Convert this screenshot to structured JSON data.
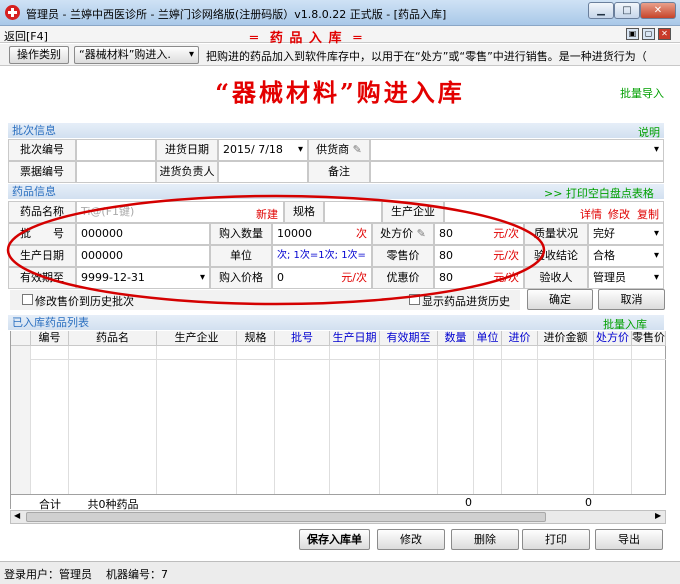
{
  "window": {
    "title": "管理员 - 兰婷中西医诊所  - 兰婷门诊网络版(注册码版）v1.8.0.22 正式版 - [药品入库]"
  },
  "menubar": {
    "back": "返回[F4]",
    "center_title": "═  药 品 入 库  ═"
  },
  "options": {
    "op_type_label": "操作类别",
    "op_type_value": "“器械材料”购进入.",
    "description": "把购进的药品加入到软件库存中，以用于在“处方”或“零售”中进行销售。是一种进货行为（"
  },
  "page": {
    "title": "“器械材料”购进入库",
    "batch_import": "批量导入"
  },
  "batch_section": {
    "header": "批次信息",
    "help": "说明",
    "batch_no_label": "批次编号",
    "date_label": "进货日期",
    "date_value": "2015/ 7/18",
    "supplier_label": "供货商",
    "invoice_label": "票据编号",
    "buyer_label": "进货负责人",
    "remark_label": "备注"
  },
  "drug_section": {
    "header": "药品信息",
    "print_blank": ">>  打印空白盘点表格",
    "name_label": "药品名称",
    "name_placeholder": "Ti@(F1键)",
    "new_link": "新建",
    "spec_label": "规格",
    "maker_label": "生产企业",
    "detail": "详情",
    "edit": "修改",
    "copy": "复制",
    "lot_label": "批　　号",
    "lot_value": "000000",
    "qty_label": "购入数量",
    "qty_value": "10000",
    "qty_unit": "次",
    "rx_price_label": "处方价",
    "rx_price_value": "80",
    "rx_price_unit": "元/次",
    "quality_label": "质量状况",
    "quality_value": "完好",
    "mfg_label": "生产日期",
    "mfg_value": "000000",
    "unit_label": "单位",
    "unit_value": "次; 1次=1次; 1次=",
    "retail_label": "零售价",
    "retail_value": "80",
    "retail_unit": "元/次",
    "accept_label": "验收结论",
    "accept_value": "合格",
    "expiry_label": "有效期至",
    "expiry_value": "9999-12-31",
    "price_label": "购入价格",
    "price_value": "0",
    "price_unit": "元/次",
    "discount_label": "优惠价",
    "discount_value": "80",
    "discount_unit": "元/次",
    "inspector_label": "验收人",
    "inspector_value": "管理员",
    "modify_history": "修改售价到历史批次",
    "show_history": "显示药品进货历史",
    "ok": "确定",
    "cancel": "取消"
  },
  "list_section": {
    "header": "已入库药品列表",
    "batch_in": "批量入库",
    "columns": [
      "编号",
      "药品名",
      "生产企业",
      "规格",
      "批号",
      "生产日期",
      "有效期至",
      "数量",
      "单位",
      "进价",
      "进价金额",
      "处方价",
      "零售价"
    ],
    "total_label": "合计",
    "total_count": "共0种药品",
    "total_qty": "0",
    "total_amount": "0"
  },
  "actions": {
    "save": "保存入库单",
    "edit": "修改",
    "delete": "删除",
    "print": "打印",
    "export": "导出"
  },
  "status": {
    "user": "登录用户：管理员",
    "machine": "机器编号：7"
  },
  "colors": {
    "accent_red": "#e00000",
    "section_blue": "#2a6fc0",
    "link_green": "#00a000"
  }
}
